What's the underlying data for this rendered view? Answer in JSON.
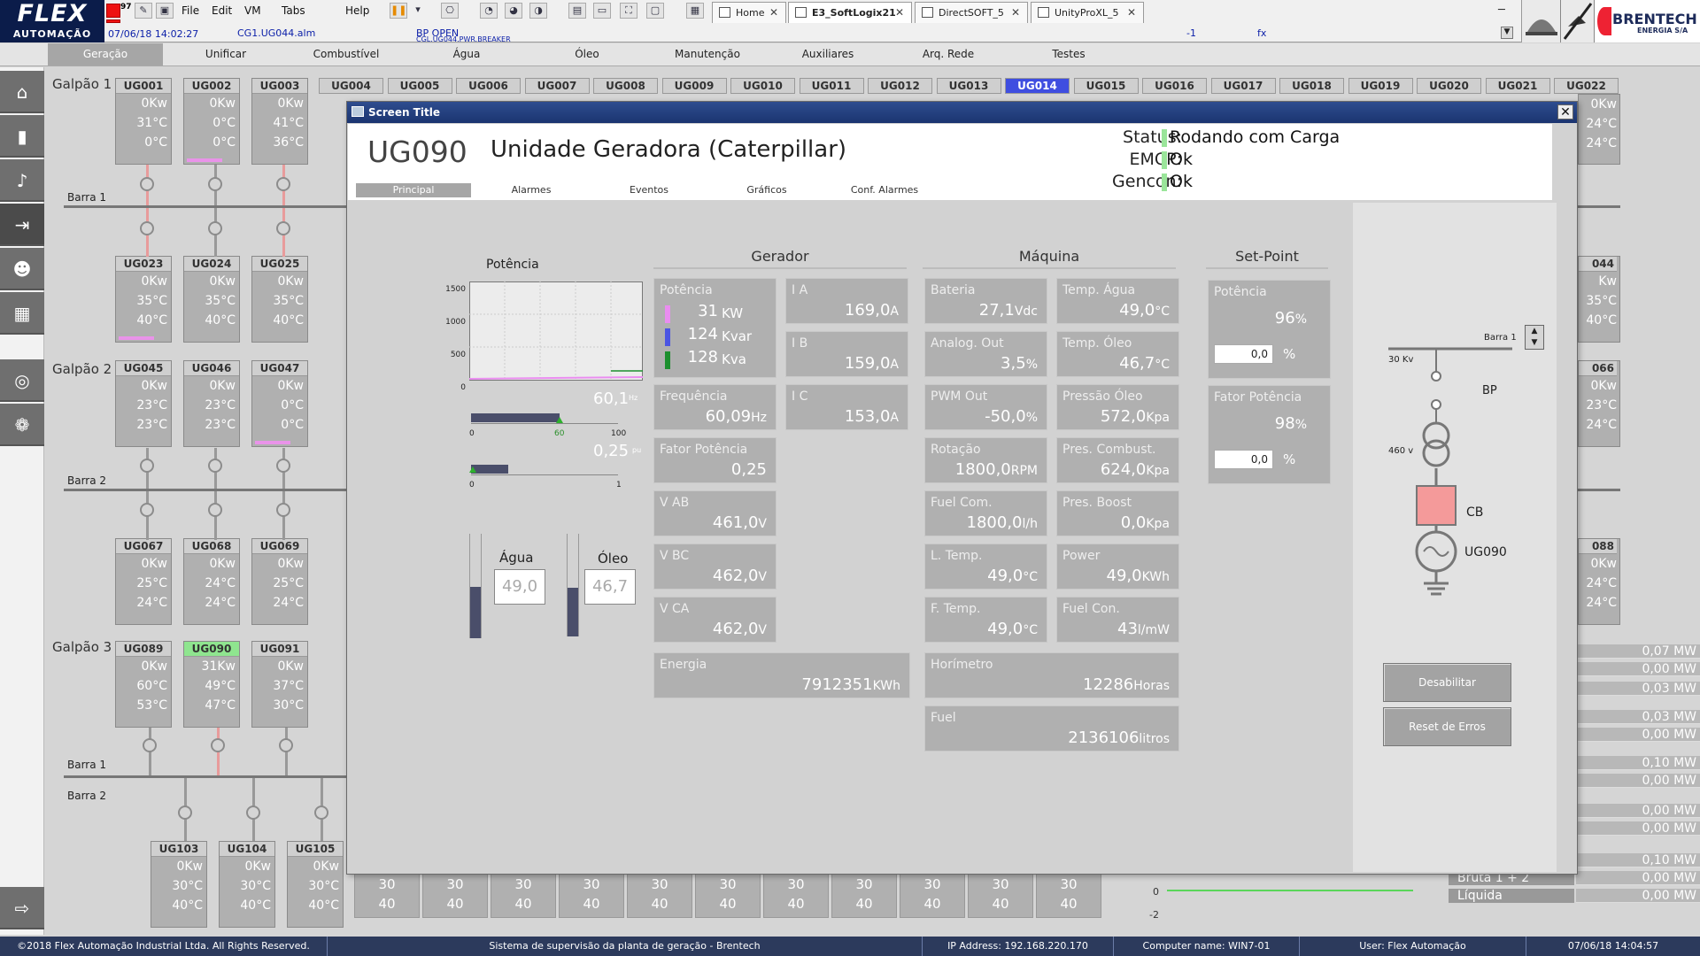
{
  "app": {
    "logo_line1": "FLEX",
    "logo_line2": "AUTOMAÇÃO",
    "menu": [
      "File",
      "Edit",
      "VM",
      "Tabs",
      "Help"
    ],
    "tabs": [
      {
        "label": "Home",
        "active": false
      },
      {
        "label": "E3_SoftLogix21",
        "active": true
      },
      {
        "label": "DirectSOFT_5",
        "active": false
      },
      {
        "label": "UnityProXL_5",
        "active": false
      }
    ],
    "alarm_date": "07/06/18 14:02:27",
    "alarm_tag": "CG1.UG044.alm",
    "alarm_msg": "BP OPEN",
    "alarm_msg2": "CGL.UG044.PWR.BREAKER",
    "alarm_count": "-1",
    "alarm_fx": "fx",
    "brand_name": "BRENTECH",
    "brand_sub": "ENERGIA S/A",
    "badge_count": "97"
  },
  "nav": [
    {
      "label": "Geração",
      "active": true
    },
    {
      "label": "Unificar"
    },
    {
      "label": "Combustível"
    },
    {
      "label": "Água"
    },
    {
      "label": "Óleo"
    },
    {
      "label": "Manutenção"
    },
    {
      "label": "Auxiliares"
    },
    {
      "label": "Arq. Rede"
    },
    {
      "label": "Testes"
    }
  ],
  "sidebar_icons": [
    "home-icon",
    "chart-icon",
    "bell-icon",
    "login-icon",
    "user-icon",
    "calculator-icon",
    "globe-icon",
    "palette-icon",
    "logout-icon"
  ],
  "background": {
    "galpao1": "Galpão 1",
    "galpao2": "Galpão 2",
    "galpao3": "Galpão 3",
    "barra1": "Barra 1",
    "barra2": "Barra 2",
    "header_units": [
      "UG004",
      "UG005",
      "UG006",
      "UG007",
      "UG008",
      "UG009",
      "UG010",
      "UG011",
      "UG012",
      "UG013",
      "UG014",
      "UG015",
      "UG016",
      "UG017",
      "UG018",
      "UG019",
      "UG020",
      "UG021",
      "UG022"
    ],
    "selected_header": "UG014",
    "row1": [
      {
        "name": "UG001",
        "kw": "0",
        "t1": "31",
        "t2": "0"
      },
      {
        "name": "UG002",
        "kw": "0",
        "t1": "0",
        "t2": "0",
        "bar": true
      },
      {
        "name": "UG003",
        "kw": "0",
        "t1": "41",
        "t2": "36"
      }
    ],
    "row2": [
      {
        "name": "UG023",
        "kw": "0",
        "t1": "35",
        "t2": "40",
        "bar": true
      },
      {
        "name": "UG024",
        "kw": "0",
        "t1": "35",
        "t2": "40"
      },
      {
        "name": "UG025",
        "kw": "0",
        "t1": "35",
        "t2": "40"
      }
    ],
    "row3": [
      {
        "name": "UG045",
        "kw": "0",
        "t1": "23",
        "t2": "23"
      },
      {
        "name": "UG046",
        "kw": "0",
        "t1": "23",
        "t2": "23"
      },
      {
        "name": "UG047",
        "kw": "0",
        "t1": "0",
        "t2": "0",
        "bar": true
      }
    ],
    "row4": [
      {
        "name": "UG067",
        "kw": "0",
        "t1": "25",
        "t2": "24"
      },
      {
        "name": "UG068",
        "kw": "0",
        "t1": "24",
        "t2": "24"
      },
      {
        "name": "UG069",
        "kw": "0",
        "t1": "25",
        "t2": "24"
      }
    ],
    "row5": [
      {
        "name": "UG089",
        "kw": "0",
        "t1": "60",
        "t2": "53"
      },
      {
        "name": "UG090",
        "kw": "31",
        "t1": "49",
        "t2": "47",
        "green": true
      },
      {
        "name": "UG091",
        "kw": "0",
        "t1": "37",
        "t2": "30"
      }
    ],
    "row6": [
      {
        "name": "UG103",
        "kw": "0",
        "t1": "30",
        "t2": "40"
      },
      {
        "name": "UG104",
        "kw": "0",
        "t1": "30",
        "t2": "40"
      },
      {
        "name": "UG105",
        "kw": "0",
        "t1": "30",
        "t2": "40"
      }
    ],
    "right_stubs": [
      {
        "name": "044",
        "kw": "",
        "t1": "35",
        "t2": "40"
      },
      {
        "name": "066",
        "kw": "0",
        "t1": "23",
        "t2": "24"
      },
      {
        "name": "088",
        "kw": "0",
        "t1": "24",
        "t2": "24"
      }
    ],
    "right_top": {
      "kw": "0",
      "t1": "24",
      "t2": "24"
    },
    "kw_unit": "Kw",
    "temp_unit": "°C",
    "bottom_temps": {
      "t1": "30",
      "t2": "40"
    },
    "mw_values": [
      "0,07",
      "0,00",
      "0,03",
      "0,03",
      "0,00",
      "0,10",
      "0,00",
      "0,00",
      "0,00",
      "0,10",
      "0,00",
      "0,00"
    ],
    "mw_unit": "MW",
    "mw_labels": [
      "Bruta 1 + 2",
      "Líquida"
    ],
    "plot_axis": [
      "0",
      "-2"
    ]
  },
  "dialog": {
    "title": "Screen Title",
    "unit": "UG090",
    "desc": "Unidade Geradora (Caterpillar)",
    "status": [
      {
        "label": "Status:",
        "value": "Rodando com Carga"
      },
      {
        "label": "EMCP:",
        "value": "Ok"
      },
      {
        "label": "Gencon:",
        "value": "Ok"
      }
    ],
    "tabs": [
      {
        "label": "Principal",
        "active": true
      },
      {
        "label": "Alarmes"
      },
      {
        "label": "Eventos"
      },
      {
        "label": "Gráficos"
      },
      {
        "label": "Conf. Alarmes"
      }
    ],
    "potencia_chart": {
      "title": "Potência",
      "yticks": [
        "1500",
        "1000",
        "500",
        "0"
      ]
    },
    "freq_gauge": {
      "value": "60,1",
      "unit": "Hz",
      "min": "0",
      "mark": "60",
      "max": "100",
      "fill": 0.6
    },
    "pf_gauge": {
      "value": "0,25",
      "unit": "pu",
      "min": "0",
      "max": "1",
      "fill": 0.25
    },
    "agua": {
      "label": "Água",
      "value": "49,0",
      "fill": 0.49
    },
    "oleo": {
      "label": "Óleo",
      "value": "46,7",
      "fill": 0.47
    },
    "sections": {
      "gerador": "Gerador",
      "maquina": "Máquina",
      "setpoint": "Set-Point"
    },
    "potencia": {
      "label": "Potência",
      "kw": "31",
      "kw_u": "KW",
      "kvar": "124",
      "kvar_u": "Kvar",
      "kva": "128",
      "kva_u": "Kva",
      "colors": [
        "#ea8df0",
        "#4b55e3",
        "#1c8f2e"
      ]
    },
    "gerador_left": [
      {
        "label": "Frequência",
        "value": "60,09",
        "unit": "Hz"
      },
      {
        "label": "Fator Potência",
        "value": "0,25",
        "unit": ""
      },
      {
        "label": "V AB",
        "value": "461,0",
        "unit": "V"
      },
      {
        "label": "V BC",
        "value": "462,0",
        "unit": "V"
      },
      {
        "label": "V CA",
        "value": "462,0",
        "unit": "V"
      }
    ],
    "gerador_right": [
      {
        "label": "I A",
        "value": "169,0",
        "unit": "A"
      },
      {
        "label": "I B",
        "value": "159,0",
        "unit": "A"
      },
      {
        "label": "I C",
        "value": "153,0",
        "unit": "A"
      }
    ],
    "energia": {
      "label": "Energia",
      "value": "7912351",
      "unit": "KWh"
    },
    "maquina_left": [
      {
        "label": "Bateria",
        "value": "27,1",
        "unit": "Vdc"
      },
      {
        "label": "Analog. Out",
        "value": "3,5",
        "unit": "%"
      },
      {
        "label": "PWM Out",
        "value": "-50,0",
        "unit": "%"
      },
      {
        "label": "Rotação",
        "value": "1800,0",
        "unit": "RPM"
      },
      {
        "label": "Fuel Com.",
        "value": "1800,0",
        "unit": "l/h"
      },
      {
        "label": "L. Temp.",
        "value": "49,0",
        "unit": "°C"
      },
      {
        "label": "F. Temp.",
        "value": "49,0",
        "unit": "°C"
      }
    ],
    "maquina_right": [
      {
        "label": "Temp. Água",
        "value": "49,0",
        "unit": "°C"
      },
      {
        "label": "Temp. Óleo",
        "value": "46,7",
        "unit": "°C"
      },
      {
        "label": "Pressão Óleo",
        "value": "572,0",
        "unit": "Kpa"
      },
      {
        "label": "Pres. Combust.",
        "value": "624,0",
        "unit": "Kpa"
      },
      {
        "label": "Pres. Boost",
        "value": "0,0",
        "unit": "Kpa"
      },
      {
        "label": "Power",
        "value": "49,0",
        "unit": "KWh"
      },
      {
        "label": "Fuel Con.",
        "value": "43",
        "unit": "l/mW"
      }
    ],
    "horimetro": {
      "label": "Horímetro",
      "value": "12286",
      "unit": "Horas"
    },
    "fuel": {
      "label": "Fuel",
      "value": "2136106",
      "unit": "litros"
    },
    "setpoint_potencia": {
      "label": "Potência",
      "value": "96",
      "unit": "%",
      "input": "0,0"
    },
    "setpoint_fp": {
      "label": "Fator Potência",
      "value": "98",
      "unit": "%",
      "input": "0,0"
    },
    "diagram": {
      "barra": "Barra 1",
      "kv": "30 Kv",
      "bp": "BP",
      "v460": "460 v",
      "cb": "CB",
      "ug": "UG090"
    },
    "buttons": {
      "disable": "Desabilitar",
      "reset": "Reset de Erros"
    }
  },
  "status_bar": {
    "copyright": "©2018 Flex Automação Industrial Ltda. All Rights Reserved.",
    "system": "Sistema de supervisão da planta de geração - Brentech",
    "ip": "IP Address: 192.168.220.170",
    "computer": "Computer name: WIN7-01",
    "user": "User: Flex Automação",
    "datetime": "07/06/18 14:04:57"
  }
}
